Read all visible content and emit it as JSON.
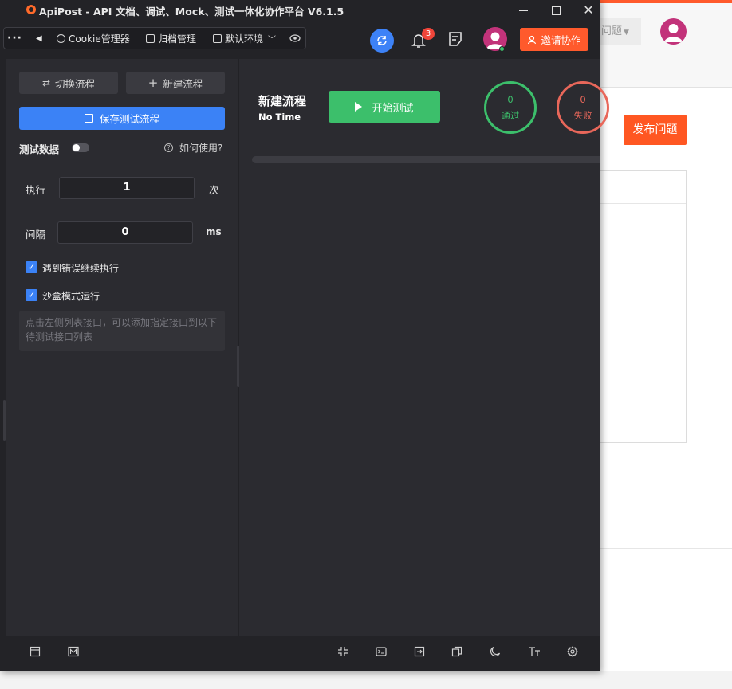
{
  "window": {
    "title": "ApiPost - API 文档、调试、Mock、测试一体化协作平台 V6.1.5"
  },
  "toolbar": {
    "more": "···",
    "cookie_manager": "Cookie管理器",
    "archive_manager": "归档管理",
    "environment": "默认环境",
    "notification_count": "3",
    "invite_label": "邀请协作"
  },
  "left_panel": {
    "switch_flow": "切换流程",
    "new_flow": "新建流程",
    "save_flow": "保存测试流程",
    "test_data_label": "测试数据",
    "test_data_enabled": false,
    "how_to_use": "如何使用?",
    "exec_label": "执行",
    "exec_value": "1",
    "exec_unit": "次",
    "interval_label": "间隔",
    "interval_value": "0",
    "interval_unit": "ms",
    "continue_on_error": "遇到错误继续执行",
    "continue_on_error_checked": true,
    "sandbox_mode": "沙盒模式运行",
    "sandbox_mode_checked": true,
    "hint": "点击左侧列表接口，可以添加指定接口到以下待测试接口列表"
  },
  "main": {
    "flow_title": "新建流程",
    "flow_time": "No Time",
    "start_button": "开始测试",
    "pass_count": "0",
    "pass_label": "通过",
    "fail_count": "0",
    "fail_label": "失败",
    "progress_percent": 0
  },
  "background_page": {
    "issue_tab": "问题",
    "publish_button": "发布问题"
  },
  "colors": {
    "accent_blue": "#3b82f6",
    "success_green": "#3cbf6b",
    "fail_red": "#e8675a",
    "brand_orange": "#ff5a2c"
  }
}
